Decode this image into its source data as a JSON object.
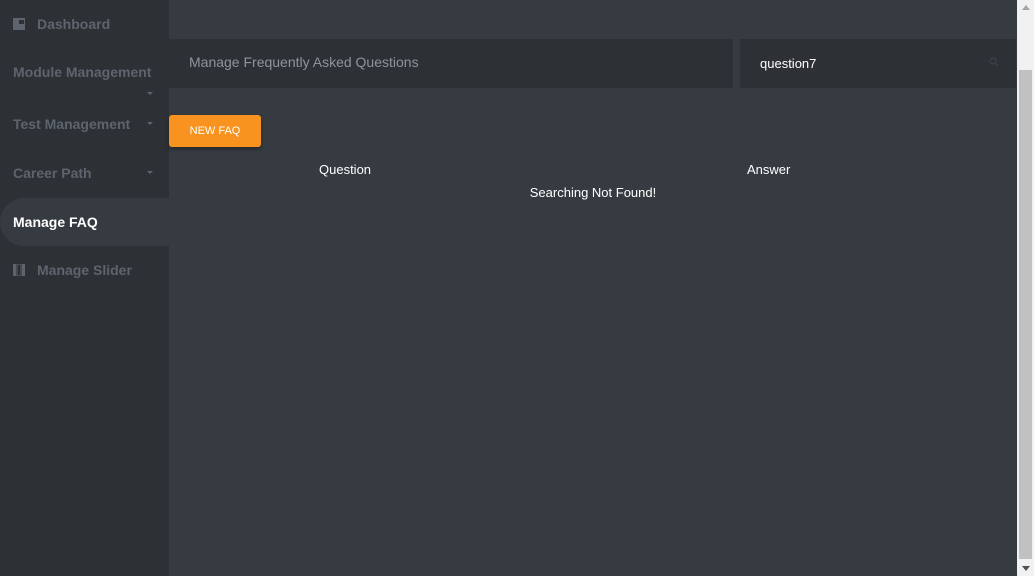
{
  "sidebar": {
    "items": [
      {
        "label": "Dashboard",
        "icon": "dashboard-icon",
        "has_caret": false,
        "active": false
      },
      {
        "label": "Module Management",
        "has_caret": true,
        "active": false
      },
      {
        "label": "Test Management",
        "has_caret": true,
        "active": false
      },
      {
        "label": "Career Path",
        "has_caret": true,
        "active": false
      },
      {
        "label": "Manage FAQ",
        "has_caret": false,
        "active": true
      },
      {
        "label": "Manage Slider",
        "icon": "slider-icon",
        "has_caret": false,
        "active": false
      }
    ]
  },
  "header": {
    "title": "Manage Frequently Asked Questions"
  },
  "search": {
    "value": "question7",
    "icon": "search-icon"
  },
  "toolbar": {
    "new_faq_label": "NEW FAQ"
  },
  "table": {
    "columns": [
      "Question",
      "Answer"
    ],
    "empty_message": "Searching Not Found!"
  },
  "colors": {
    "sidebar_bg": "#2d3136",
    "main_bg": "#363b42",
    "accent": "#f7931e",
    "muted_text": "#5d646d"
  }
}
